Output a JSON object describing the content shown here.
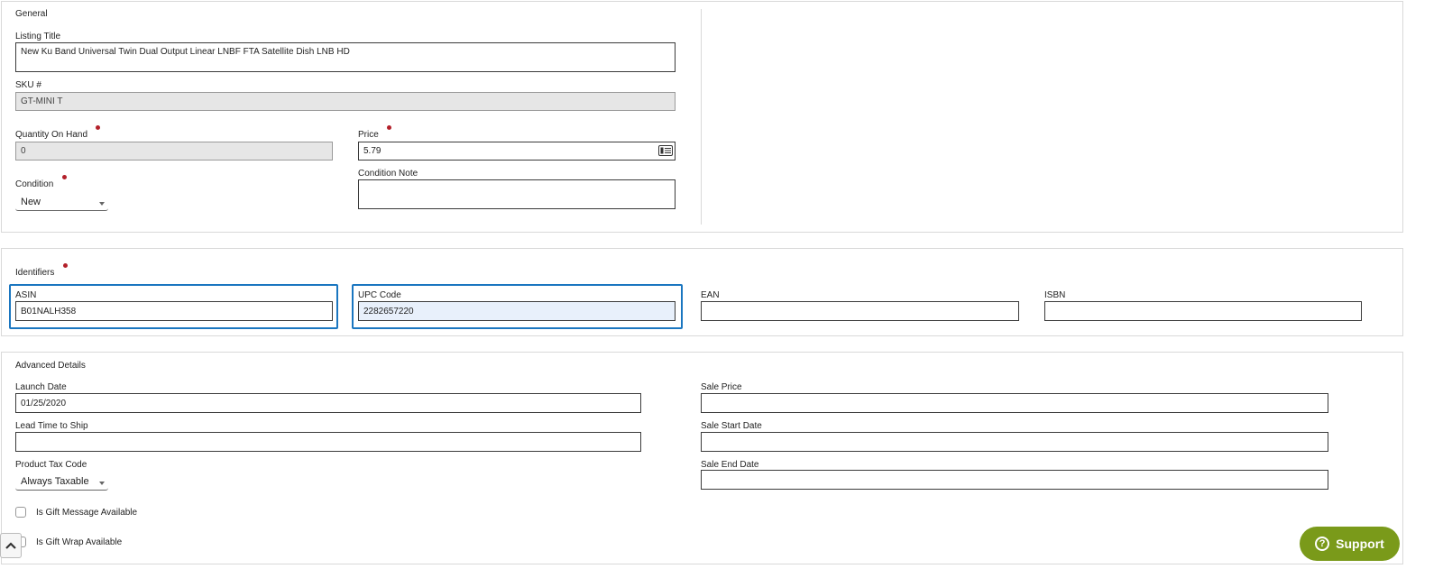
{
  "general": {
    "section_title": "General",
    "listing_title_label": "Listing Title",
    "listing_title_value": "New Ku Band Universal Twin Dual Output Linear LNBF FTA Satellite Dish LNB HD",
    "sku_label": "SKU #",
    "sku_value": "GT-MINI T",
    "quantity_label": "Quantity On Hand",
    "quantity_value": "0",
    "price_label": "Price",
    "price_value": "5.79",
    "condition_label": "Condition",
    "condition_value": "New",
    "condition_note_label": "Condition Note",
    "condition_note_value": ""
  },
  "identifiers": {
    "section_title": "Identifiers",
    "asin_label": "ASIN",
    "asin_value": "B01NALH358",
    "upc_label": "UPC Code",
    "upc_value": "2282657220",
    "ean_label": "EAN",
    "ean_value": "",
    "isbn_label": "ISBN",
    "isbn_value": ""
  },
  "advanced": {
    "section_title": "Advanced Details",
    "launch_date_label": "Launch Date",
    "launch_date_value": "01/25/2020",
    "lead_time_label": "Lead Time to Ship",
    "lead_time_value": "",
    "tax_code_label": "Product Tax Code",
    "tax_code_value": "Always Taxable",
    "sale_price_label": "Sale Price",
    "sale_price_value": "",
    "sale_start_label": "Sale Start Date",
    "sale_start_value": "",
    "sale_end_label": "Sale End Date",
    "sale_end_value": "",
    "gift_message_label": "Is Gift Message Available",
    "gift_message_checked": false,
    "gift_wrap_label": "Is Gift Wrap Available",
    "gift_wrap_checked": false
  },
  "support": {
    "label": "Support",
    "icon": "question-icon"
  },
  "scroll_top": {
    "icon": "chevron-up-icon"
  },
  "colors": {
    "required_dot": "#b3202a",
    "focus_border": "#1a76c0",
    "support_bg": "#7a9a1a",
    "readonly_bg": "#e6e6e6"
  }
}
